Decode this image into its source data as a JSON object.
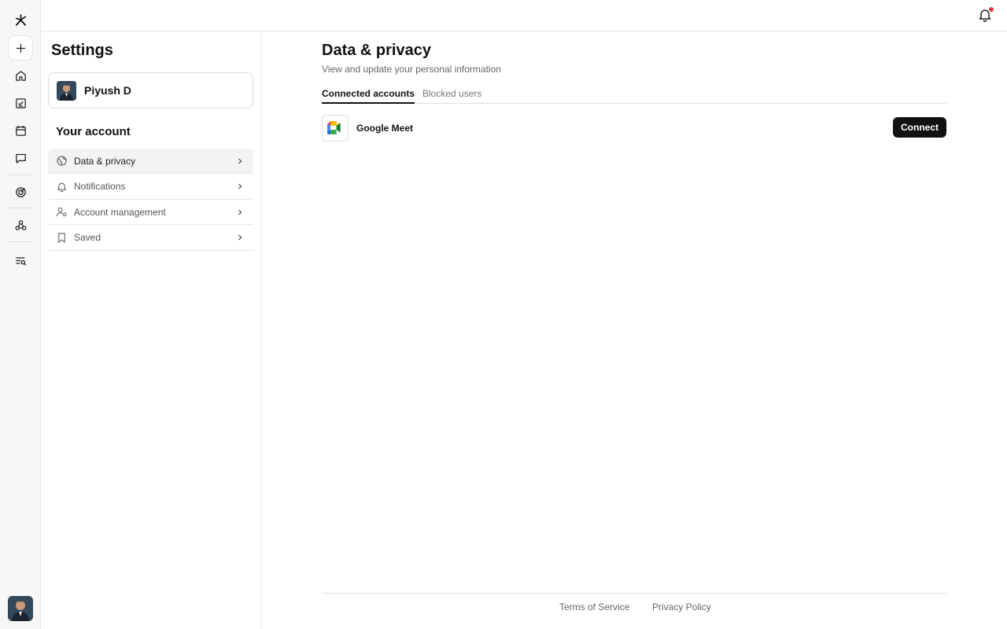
{
  "app": {
    "logo_icon": "asterisk-logo-icon",
    "notification_indicator_color": "#e53935"
  },
  "rail": {
    "items": [
      {
        "id": "new",
        "icon": "plus-icon"
      },
      {
        "id": "home",
        "icon": "home-icon"
      },
      {
        "id": "tasks",
        "icon": "task-list-icon"
      },
      {
        "id": "calendar",
        "icon": "calendar-icon"
      },
      {
        "id": "chat",
        "icon": "chat-bubble-icon"
      },
      {
        "id": "goals",
        "icon": "target-icon"
      },
      {
        "id": "integrations",
        "icon": "webhook-icon"
      },
      {
        "id": "search",
        "icon": "search-list-icon"
      }
    ]
  },
  "settings": {
    "title": "Settings",
    "profile": {
      "name": "Piyush D"
    },
    "section_title": "Your account",
    "menu": [
      {
        "label": "Data & privacy",
        "icon": "globe-icon",
        "active": true
      },
      {
        "label": "Notifications",
        "icon": "bell-icon",
        "active": false
      },
      {
        "label": "Account management",
        "icon": "user-gear-icon",
        "active": false
      },
      {
        "label": "Saved",
        "icon": "bookmark-icon",
        "active": false
      }
    ]
  },
  "main": {
    "title": "Data & privacy",
    "subtitle": "View and update your personal information",
    "tabs": [
      {
        "label": "Connected accounts",
        "active": true
      },
      {
        "label": "Blocked users",
        "active": false
      }
    ],
    "accounts": [
      {
        "name": "Google Meet",
        "icon": "google-meet-icon",
        "action_label": "Connect"
      }
    ]
  },
  "footer": {
    "terms": "Terms of Service",
    "privacy": "Privacy Policy"
  }
}
